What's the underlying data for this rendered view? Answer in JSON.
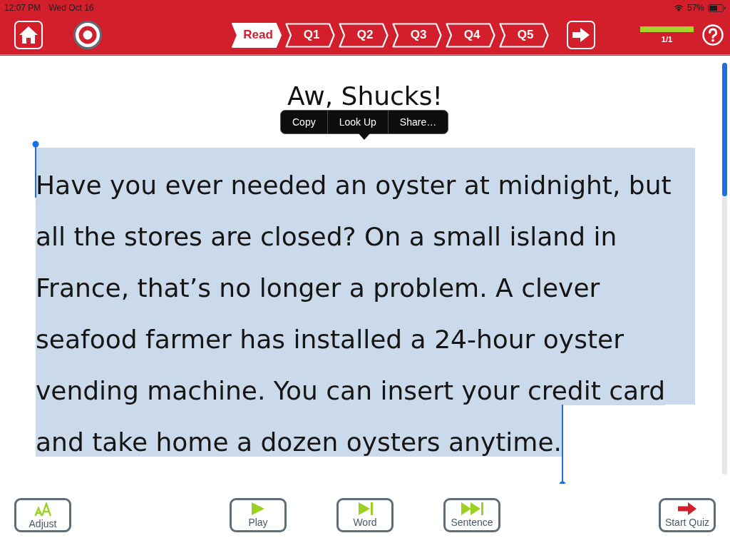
{
  "status_bar": {
    "time": "12:07 PM",
    "date": "Wed Oct 16",
    "battery": "57%"
  },
  "toolbar": {
    "tabs": [
      {
        "label": "Read",
        "selected": true
      },
      {
        "label": "Q1",
        "selected": false
      },
      {
        "label": "Q2",
        "selected": false
      },
      {
        "label": "Q3",
        "selected": false
      },
      {
        "label": "Q4",
        "selected": false
      },
      {
        "label": "Q5",
        "selected": false
      }
    ],
    "progress": {
      "level": 1,
      "reading": "1/1"
    }
  },
  "article": {
    "title": "Aw, Shucks!",
    "body": {
      "text": "Have you ever needed an oyster at midnight, but all the stores are closed? On a small island in France, that’s no longer a problem. A clever seafood farmer has installed a 24-hour oyster vending machine. You can insert your credit card and take home a dozen oysters anytime.",
      "selected": true
    }
  },
  "context_menu": {
    "items": [
      "Copy",
      "Look Up",
      "Share…"
    ]
  },
  "bottom_bar": {
    "buttons": [
      {
        "kind": "adjust",
        "label": "Adjust"
      },
      {
        "kind": "play",
        "label": "Play"
      },
      {
        "kind": "word",
        "label": "Word"
      },
      {
        "kind": "sentence",
        "label": "Sentence"
      },
      {
        "kind": "quiz",
        "label": "Start Quiz"
      }
    ]
  }
}
